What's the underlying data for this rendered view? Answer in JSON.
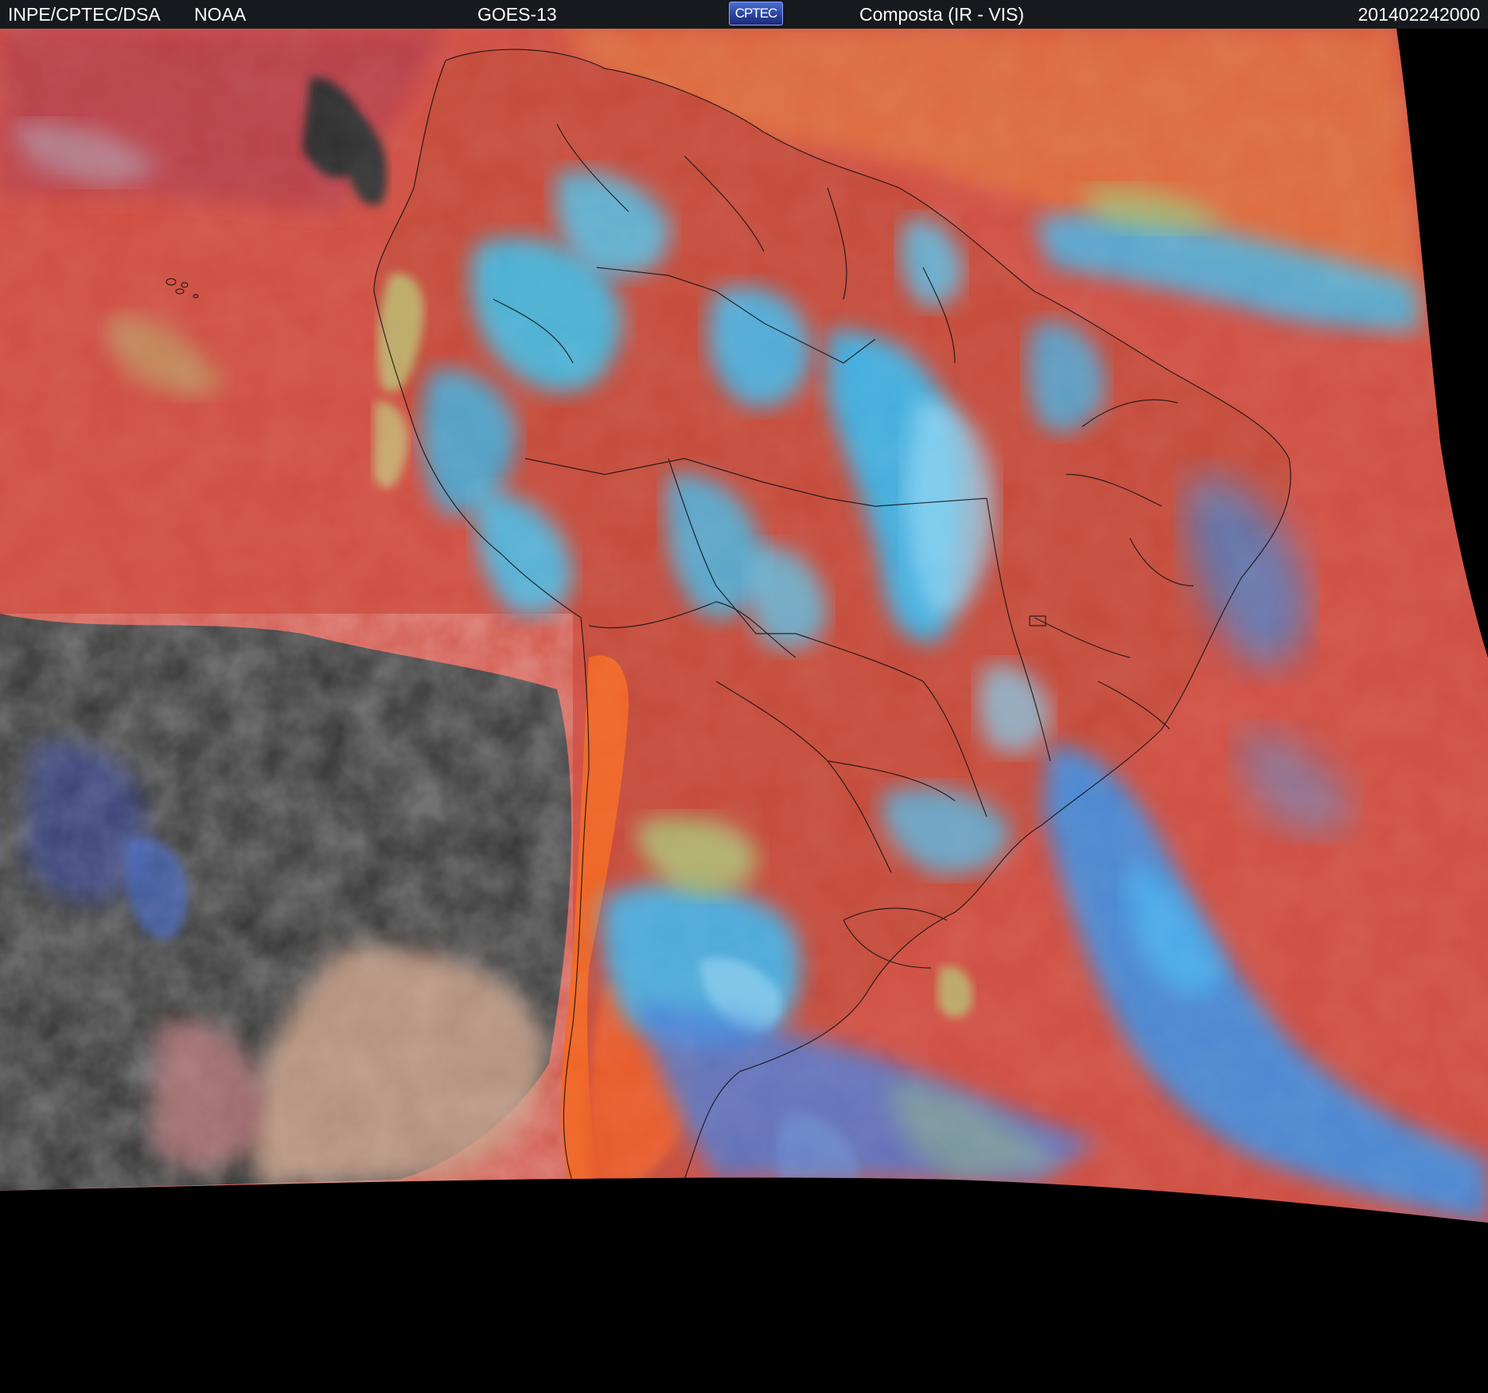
{
  "header": {
    "institution": "INPE/CPTEC/DSA",
    "agency": "NOAA",
    "satellite": "GOES-13",
    "logo_text": "CPTEC",
    "product": "Composta (IR - VIS)",
    "timestamp": "201402242000"
  },
  "map": {
    "region": "South America",
    "colors": {
      "background_space": "#000000",
      "ocean_warm": "#cf4e42",
      "ocean_cold": "#303030",
      "high_cloud": "#39c3f0",
      "mid_cloud": "#3f7ee0",
      "low_cloud": "#a8c46c",
      "land_dry": "#e0582a",
      "border_lines": "#111111",
      "banner_bg": "#16191d"
    }
  }
}
